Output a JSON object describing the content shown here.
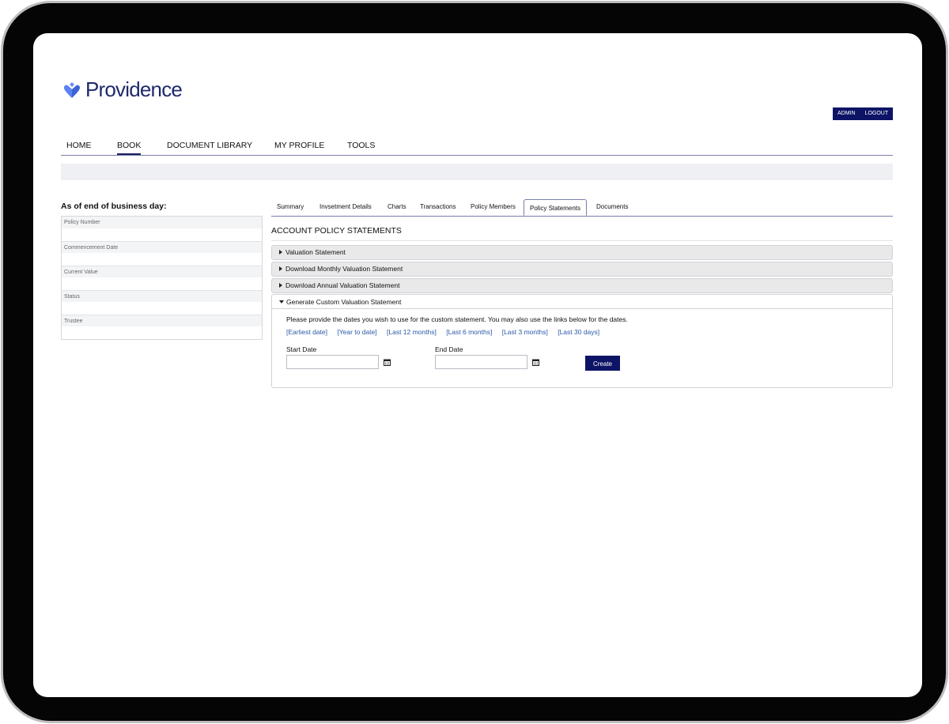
{
  "brand": {
    "name": "Providence",
    "color": "#1f2a6b",
    "logo_icon": "heart-shield-icon"
  },
  "top_buttons": {
    "admin": "ADMIN",
    "logout": "LOGOUT"
  },
  "main_nav": [
    {
      "label": "HOME",
      "active": false
    },
    {
      "label": "BOOK",
      "active": true
    },
    {
      "label": "DOCUMENT LIBRARY",
      "active": false
    },
    {
      "label": "MY PROFILE",
      "active": false
    },
    {
      "label": "TOOLS",
      "active": false
    }
  ],
  "sidebar": {
    "title": "As of end of business day:",
    "fields": [
      "Policy Number",
      "Commencement Date",
      "Current Value",
      "Status",
      "Trustee"
    ]
  },
  "tabs": [
    {
      "label": "Summary",
      "active": false
    },
    {
      "label": "Invsetment Details",
      "active": false
    },
    {
      "label": "Charts",
      "active": false
    },
    {
      "label": "Transactions",
      "active": false
    },
    {
      "label": "Policy Members",
      "active": false
    },
    {
      "label": "Policy Statements",
      "active": true
    },
    {
      "label": "Documents",
      "active": false
    }
  ],
  "section_title": "ACCOUNT POLICY STATEMENTS",
  "accordion": [
    "Valuation Statement",
    "Download Monthly Valuation Statement",
    "Download Annual Valuation Statement"
  ],
  "custom_panel": {
    "title": "Generate Custom Valuation Statement",
    "instructions": "Please provide the dates you wish to use for the custom statement. You may also use the links below for the dates.",
    "quick_links": [
      "[Earliest date]",
      "[Year to date]",
      "[Last 12 months]",
      "[Last 6 months]",
      "[Last 3 months]",
      "[Last 30 days]"
    ],
    "start_label": "Start Date",
    "end_label": "End Date",
    "start_value": "",
    "end_value": "",
    "create_label": "Create"
  },
  "colors": {
    "accent": "#0d1466",
    "link": "#2a5aa8",
    "band": "#eef0f4"
  }
}
